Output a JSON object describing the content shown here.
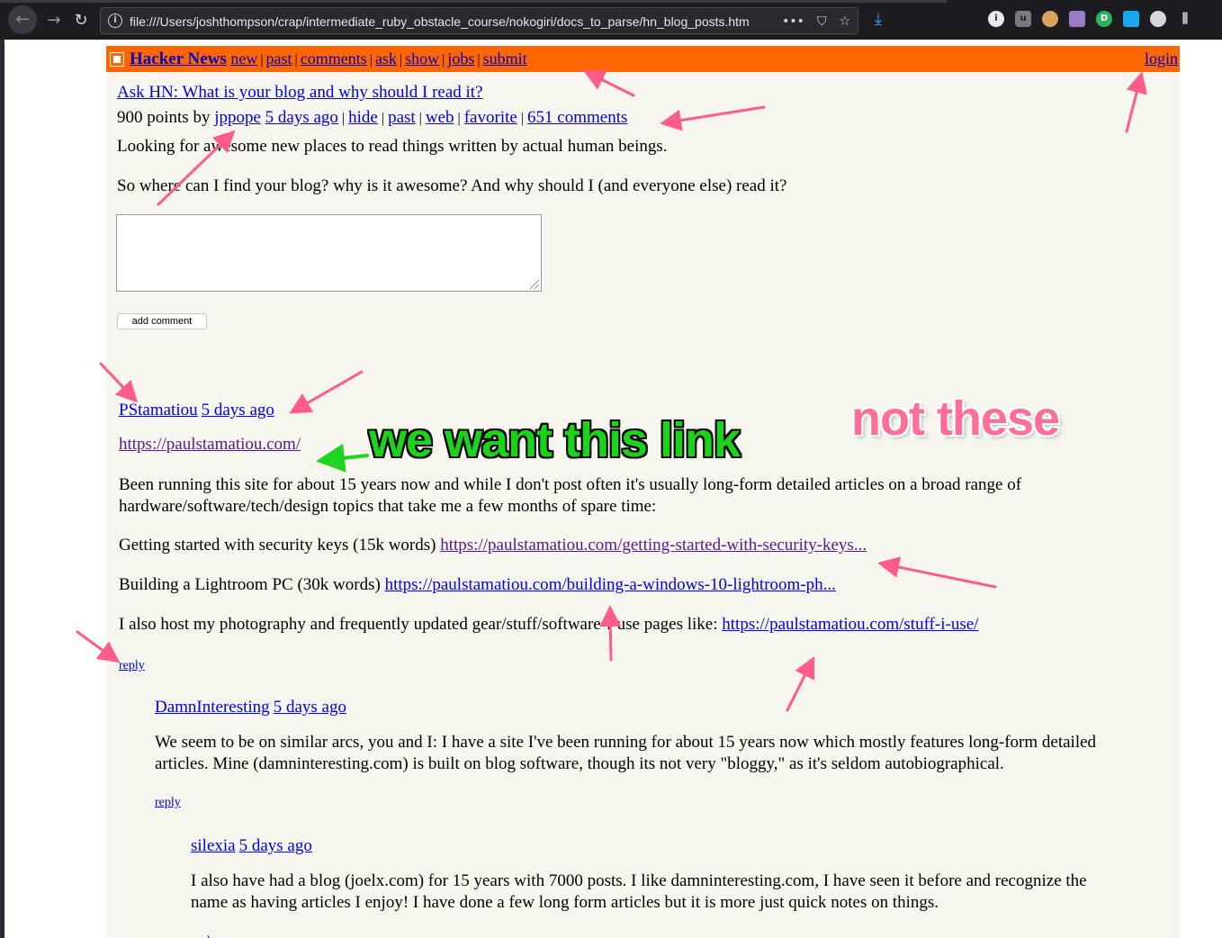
{
  "browser": {
    "url": "file:///Users/joshthompson/crap/intermediate_ruby_obstacle_course/nokogiri/docs_to_parse/hn_blog_posts.htm",
    "back_icon": "arrow-left-icon",
    "forward_icon": "arrow-right-icon",
    "reload_icon": "reload-icon",
    "more_label": "•••",
    "download_icon": "download-icon",
    "extension_icons": [
      "info-icon",
      "ublock-icon",
      "cookie-icon",
      "github-icon",
      "green-d-icon",
      "blue-gem-icon",
      "account-icon",
      "library-icon"
    ]
  },
  "hn": {
    "site_title": "Hacker News",
    "nav": [
      "new",
      "past",
      "comments",
      "ask",
      "show",
      "jobs",
      "submit"
    ],
    "login": "login",
    "accent": "#ff6600",
    "background": "#f6f6ef"
  },
  "story": {
    "title": "Ask HN: What is your blog and why should I read it?",
    "points": "900 points by",
    "user": "jppope",
    "age": "5 days ago",
    "actions": [
      "hide",
      "past",
      "web",
      "favorite"
    ],
    "comments": "651 comments",
    "text_1": "Looking for awesome new places to read things written by actual human beings.",
    "text_2": "So where can I find your blog? why is it awesome? And why should I (and everyone else) read it?",
    "add_comment_button": "add comment"
  },
  "comments": [
    {
      "user": "PStamatiou",
      "age": "5 days ago",
      "url": "https://paulstamatiou.com/",
      "body_1": "Been running this site for about 15 years now and while I don't post often it's usually long-form detailed articles on a broad range of",
      "body_1b": "hardware/software/tech/design topics that take me a few months of spare time:",
      "body_2_prefix": "Getting started with security keys (15k words)",
      "body_2_link": "https://paulstamatiou.com/getting-started-with-security-keys...",
      "body_3_prefix": "Building a Lightroom PC (30k words)",
      "body_3_link": "https://paulstamatiou.com/building-a-windows-10-lightroom-ph...",
      "body_4_prefix": "I also host my photography and frequently updated gear/stuff/software-i-use pages like:",
      "body_4_link": "https://paulstamatiou.com/stuff-i-use/",
      "reply": "reply"
    },
    {
      "user": "DamnInteresting",
      "age": "5 days ago",
      "body_1": "We seem to be on similar arcs, you and I: I have a site I've been running for about 15 years now which mostly features long-form detailed",
      "body_1b": "articles. Mine (damninteresting.com) is built on blog software, though its not very \"bloggy,\" as it's seldom autobiographical.",
      "reply": "reply"
    },
    {
      "user": "silexia",
      "age": "5 days ago",
      "body_1": "I also have had a blog (joelx.com) for 15 years with 7000 posts. I like damninteresting.com, I have seen it before and recognize the",
      "body_1b": "name as having articles I enjoy! I have done a few long form articles but it is more just quick notes on things.",
      "reply": "reply"
    }
  ],
  "annotations": {
    "green_label": "we want this link",
    "pink_label": "not these",
    "green_color": "#19d419",
    "pink_color": "#ff6f9a"
  }
}
